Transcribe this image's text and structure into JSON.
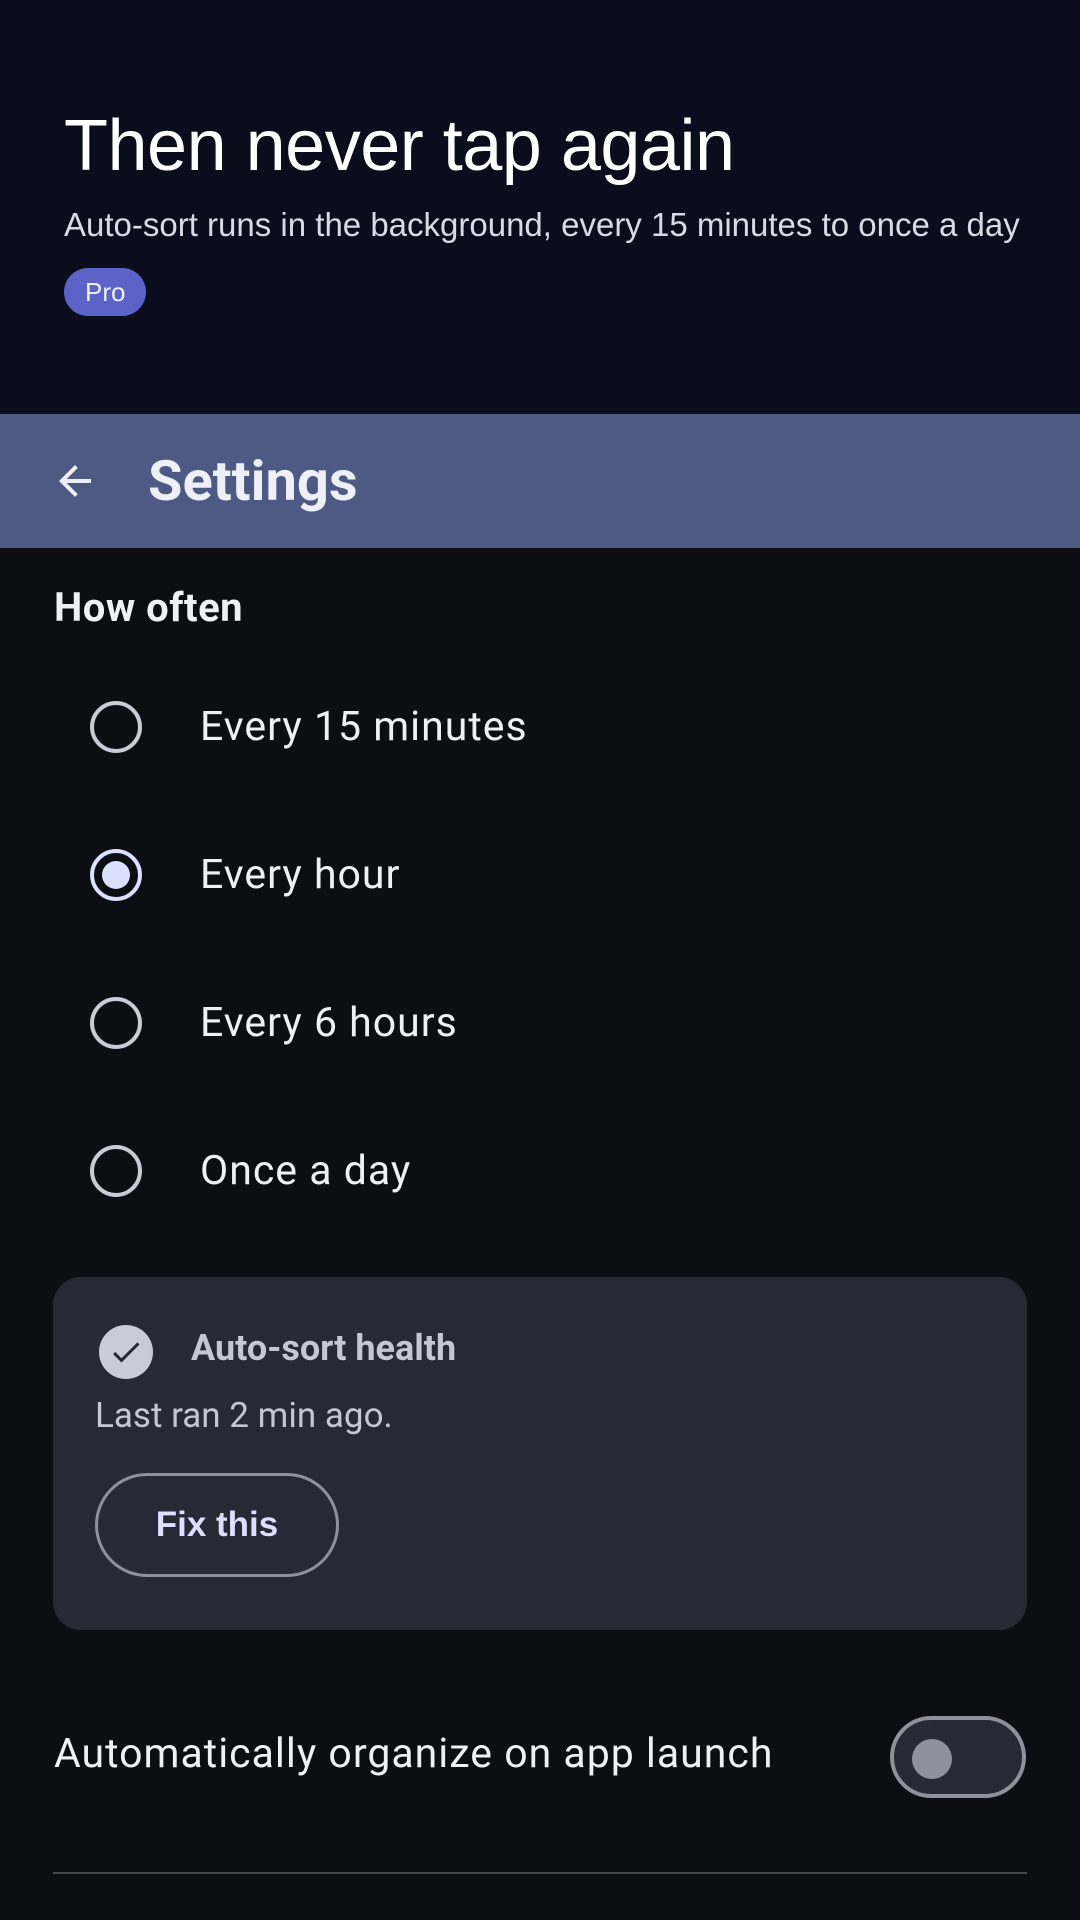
{
  "hero": {
    "title": "Then never tap again",
    "subtitle": "Auto-sort runs in the background, every 15 minutes to once a day",
    "badge": "Pro"
  },
  "topbar": {
    "back_icon": "arrow-left-icon",
    "title": "Settings"
  },
  "frequency": {
    "section_title": "How often",
    "selected": "Every hour",
    "options": [
      {
        "label": "Every 15 minutes",
        "selected": false
      },
      {
        "label": "Every hour",
        "selected": true
      },
      {
        "label": "Every 6 hours",
        "selected": false
      },
      {
        "label": "Once a day",
        "selected": false
      }
    ]
  },
  "health": {
    "icon": "check-circle-icon",
    "title": "Auto-sort health",
    "status": "Last ran 2 min ago.",
    "fix_label": "Fix this"
  },
  "launch_toggle": {
    "label": "Automatically organize on app launch",
    "enabled": false
  },
  "colors": {
    "hero_bg": "#0b0d1c",
    "topbar_bg": "#4e5a84",
    "page_bg": "#0d0e13",
    "card_bg": "#272935",
    "accent": "#dbe0ff",
    "badge_bg": "#5b63c9"
  }
}
